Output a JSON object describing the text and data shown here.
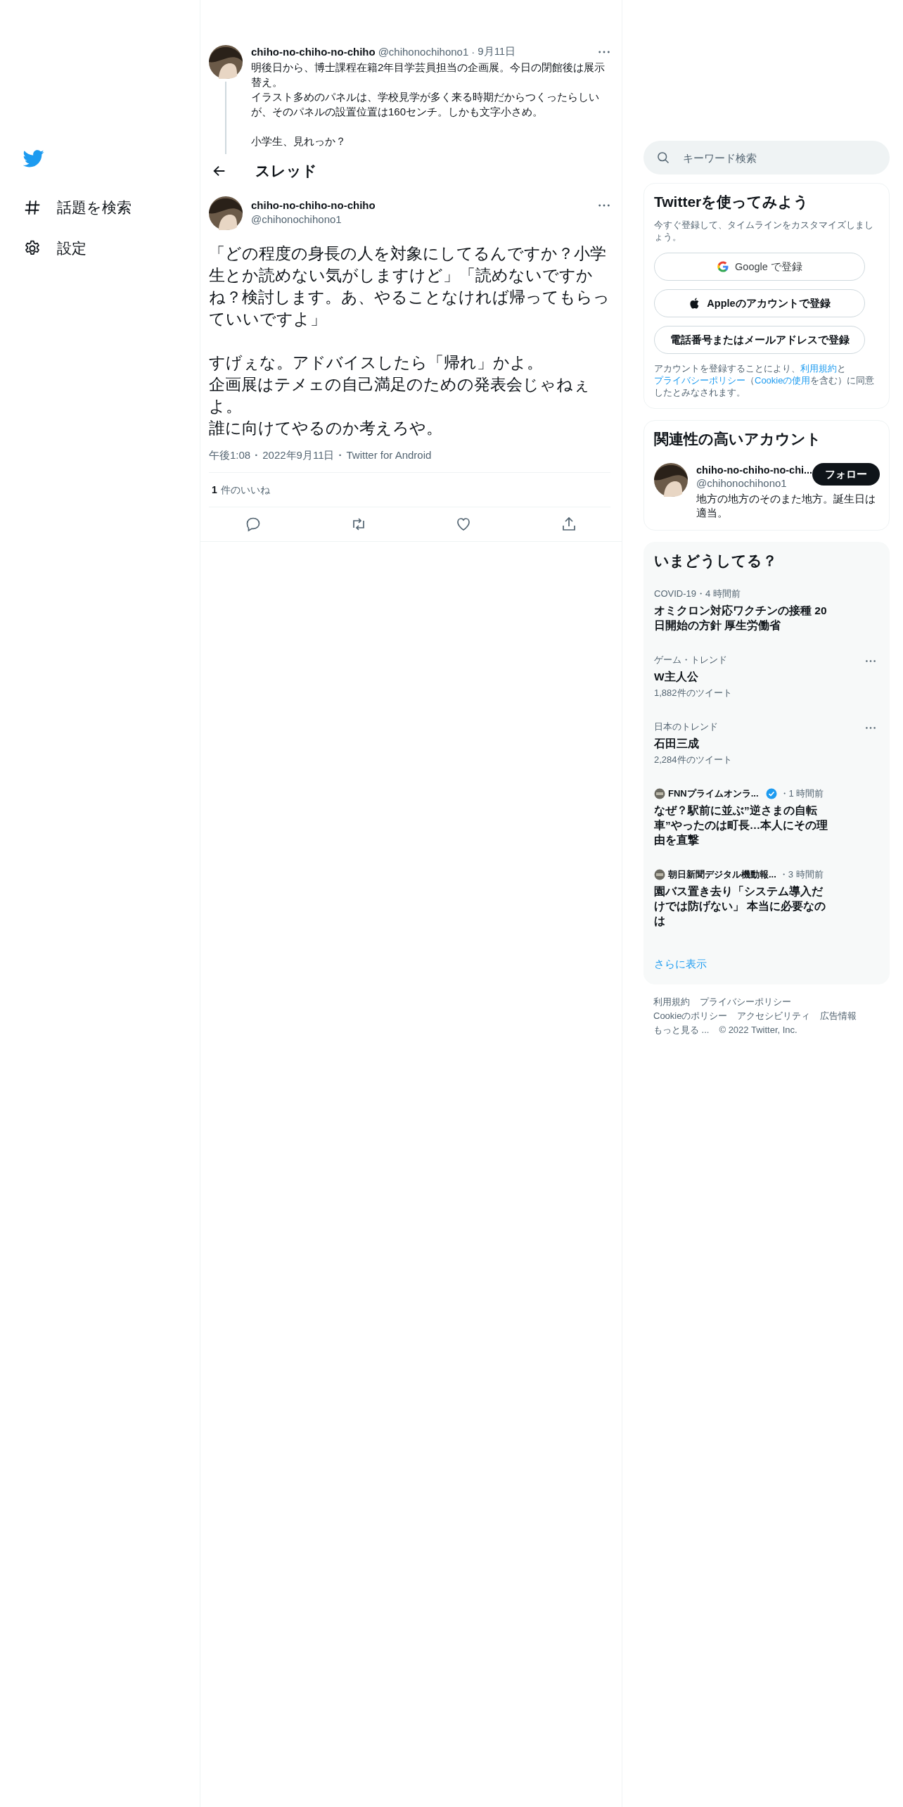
{
  "sidebar": {
    "items": [
      {
        "kind": "explore",
        "label": "話題を検索"
      },
      {
        "kind": "settings",
        "label": "設定"
      }
    ]
  },
  "parent_tweet": {
    "name": "chiho-no-chiho-no-chiho",
    "handle": "@chihonochihono1",
    "separator": "·",
    "date": "9月11日",
    "paragraphs": [
      "明後日から、博士課程在籍2年目学芸員担当の企画展。今日の閉館後は展示替え。",
      "イラスト多めのパネルは、学校見学が多く来る時期だからつくったらしいが、そのパネルの設置位置は160センチ。しかも文字小さめ。",
      "小学生、見れっか？"
    ]
  },
  "header": {
    "title": "スレッド"
  },
  "tweet": {
    "name": "chiho-no-chiho-no-chiho",
    "handle": "@chihonochihono1",
    "paragraphs": [
      "「どの程度の身長の人を対象にしてるんですか？小学生とか読めない気がしますけど」「読めないですかね？検討します。あ、やることなければ帰ってもらっていいですよ」",
      "すげぇな。アドバイスしたら「帰れ」かよ。",
      "企画展はテメェの自己満足のための発表会じゃねぇよ。",
      "誰に向けてやるのか考えろや。"
    ],
    "meta": [
      {
        "kind": "time",
        "text": "午後1:08"
      },
      {
        "kind": "separator",
        "text": "·"
      },
      {
        "kind": "date",
        "text": "2022年9月11日"
      },
      {
        "kind": "separator",
        "text": "·"
      },
      {
        "kind": "source",
        "text": "Twitter for Android"
      }
    ],
    "likes_count": "1",
    "likes_label": "件のいいね"
  },
  "search": {
    "placeholder": "キーワード検索"
  },
  "signup": {
    "title": "Twitterを使ってみよう",
    "subtitle": "今すぐ登録して、タイムラインをカスタマイズしましょう。",
    "buttons": [
      {
        "kind": "google",
        "label": "Google で登録"
      },
      {
        "kind": "apple",
        "label": "Appleのアカウントで登録"
      },
      {
        "kind": "phone",
        "label": "電話番号またはメールアドレスで登録"
      }
    ],
    "legal": [
      {
        "text": "アカウントを登録することにより、",
        "link": false
      },
      {
        "text": "利用規約",
        "link": true
      },
      {
        "text": "と",
        "link": false
      },
      {
        "text": "プライバシーポリシー",
        "link": true
      },
      {
        "text": "（",
        "link": false
      },
      {
        "text": "Cookieの使用",
        "link": true
      },
      {
        "text": "を含む）に同意したとみなされます。",
        "link": false
      }
    ]
  },
  "who_to_follow": {
    "title": "関連性の高いアカウント",
    "account": {
      "name": "chiho-no-chiho-no-chi...",
      "handle": "@chihonochihono1",
      "bio": "地方の地方のそのまた地方。誕生日は適当。",
      "button": "フォロー"
    }
  },
  "trends": {
    "title": "いまどうしてる？",
    "items": [
      {
        "kind": "topic",
        "meta": "COVID-19・4 時間前",
        "title": "オミクロン対応ワクチンの接種 20日開始の方針 厚生労働省"
      },
      {
        "kind": "trend",
        "meta": "ゲーム・トレンド",
        "title": "W主人公",
        "count": "1,882件のツイート"
      },
      {
        "kind": "trend",
        "meta": "日本のトレンド",
        "title": "石田三成",
        "count": "2,284件のツイート"
      },
      {
        "kind": "news",
        "source": "FNNプライムオンラ...",
        "verified": true,
        "time": "・1 時間前",
        "title": "なぜ？駅前に並ぶ”逆さまの自転車”やったのは町長…本人にその理由を直撃"
      },
      {
        "kind": "news",
        "source": "朝日新聞デジタル機動報...",
        "verified": false,
        "time": "・3 時間前",
        "title": "園バス置き去り「システム導入だけでは防げない」 本当に必要なのは"
      }
    ],
    "show_more": "さらに表示"
  },
  "footer": {
    "links": [
      "利用規約",
      "プライバシーポリシー",
      "Cookieのポリシー",
      "アクセシビリティ",
      "広告情報",
      "もっと見る ..."
    ],
    "copyright": "© 2022 Twitter, Inc."
  }
}
